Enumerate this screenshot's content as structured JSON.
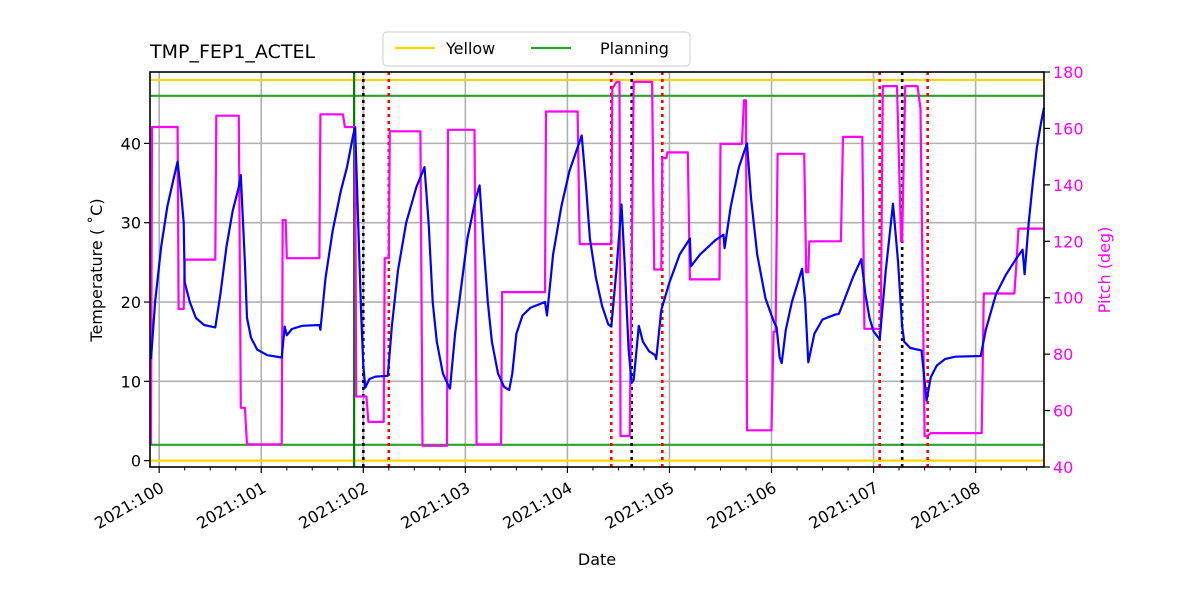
{
  "chart_data": {
    "type": "line",
    "title": "TMP_FEP1_ACTEL",
    "xlabel": "Date",
    "ylabel": "Temperature ($^\\circ$C)",
    "ylabel_display": "Temperature ( ˚C)",
    "y2label": "Pitch (deg)",
    "xlim": [
      99.91,
      108.67
    ],
    "ylim": [
      -0.8,
      49
    ],
    "y2lim": [
      40,
      180
    ],
    "grid": true,
    "legend": {
      "placement": "top-center",
      "entries": [
        {
          "label": "Yellow",
          "color": "#ffd700"
        },
        {
          "label": "Planning",
          "color": "#2ca02c"
        }
      ]
    },
    "x_ticks": [
      {
        "value": 100,
        "label": "2021:100"
      },
      {
        "value": 101,
        "label": "2021:101"
      },
      {
        "value": 102,
        "label": "2021:102"
      },
      {
        "value": 103,
        "label": "2021:103"
      },
      {
        "value": 104,
        "label": "2021:104"
      },
      {
        "value": 105,
        "label": "2021:105"
      },
      {
        "value": 106,
        "label": "2021:106"
      },
      {
        "value": 107,
        "label": "2021:107"
      },
      {
        "value": 108,
        "label": "2021:108"
      }
    ],
    "y_ticks": [
      0,
      10,
      20,
      30,
      40
    ],
    "y2_ticks": [
      40,
      60,
      80,
      100,
      120,
      140,
      160,
      180
    ],
    "limits": [
      {
        "name": "Yellow",
        "values": [
          48,
          0
        ],
        "color": "#ffd700"
      },
      {
        "name": "Planning",
        "values": [
          46,
          2
        ],
        "color": "#2ca02c"
      }
    ],
    "vlines": [
      {
        "kind": "green-solid",
        "x": 101.91,
        "color": "#008000"
      },
      {
        "kind": "black-dotted",
        "x": 102.0,
        "color": "#000000"
      },
      {
        "kind": "red-dotted",
        "x": 102.25,
        "color": "#ff0000"
      },
      {
        "kind": "red-dotted",
        "x": 104.43,
        "color": "#ff0000"
      },
      {
        "kind": "black-dotted",
        "x": 104.63,
        "color": "#000000"
      },
      {
        "kind": "red-dotted",
        "x": 104.93,
        "color": "#ff0000"
      },
      {
        "kind": "red-dotted",
        "x": 107.06,
        "color": "#ff0000"
      },
      {
        "kind": "black-dotted",
        "x": 107.28,
        "color": "#000000"
      },
      {
        "kind": "red-dotted",
        "x": 107.53,
        "color": "#ff0000"
      }
    ],
    "series": [
      {
        "name": "Temperature",
        "axis": "left",
        "color": "#0000ff",
        "points": [
          [
            99.92,
            12.8
          ],
          [
            99.96,
            20
          ],
          [
            100.02,
            27
          ],
          [
            100.08,
            32
          ],
          [
            100.14,
            35.5
          ],
          [
            100.18,
            37.7
          ],
          [
            100.22,
            33
          ],
          [
            100.24,
            30
          ],
          [
            100.25,
            22.5
          ],
          [
            100.3,
            20
          ],
          [
            100.36,
            18
          ],
          [
            100.44,
            17.1
          ],
          [
            100.55,
            16.8
          ],
          [
            100.6,
            21
          ],
          [
            100.66,
            27
          ],
          [
            100.72,
            31.5
          ],
          [
            100.78,
            34.5
          ],
          [
            100.8,
            36
          ],
          [
            100.84,
            25
          ],
          [
            100.86,
            18
          ],
          [
            100.9,
            15.5
          ],
          [
            100.96,
            14
          ],
          [
            101.06,
            13.3
          ],
          [
            101.2,
            13.0
          ],
          [
            101.23,
            16.9
          ],
          [
            101.25,
            15.8
          ],
          [
            101.3,
            16.6
          ],
          [
            101.4,
            17
          ],
          [
            101.57,
            17.1
          ],
          [
            101.58,
            16.5
          ],
          [
            101.63,
            23
          ],
          [
            101.7,
            29
          ],
          [
            101.78,
            34
          ],
          [
            101.84,
            37
          ],
          [
            101.9,
            41
          ],
          [
            101.92,
            42
          ],
          [
            101.95,
            30
          ],
          [
            101.98,
            18
          ],
          [
            102.0,
            12
          ],
          [
            102.02,
            9.2
          ],
          [
            102.06,
            10.3
          ],
          [
            102.12,
            10.6
          ],
          [
            102.24,
            10.7
          ],
          [
            102.28,
            17
          ],
          [
            102.34,
            24
          ],
          [
            102.42,
            30
          ],
          [
            102.52,
            34.5
          ],
          [
            102.6,
            37
          ],
          [
            102.64,
            30
          ],
          [
            102.68,
            20
          ],
          [
            102.72,
            15
          ],
          [
            102.78,
            11
          ],
          [
            102.84,
            9.3
          ],
          [
            102.85,
            9.1
          ],
          [
            102.9,
            16
          ],
          [
            102.96,
            22
          ],
          [
            103.02,
            28
          ],
          [
            103.1,
            33
          ],
          [
            103.14,
            34.7
          ],
          [
            103.18,
            27
          ],
          [
            103.22,
            20
          ],
          [
            103.26,
            15
          ],
          [
            103.32,
            11
          ],
          [
            103.38,
            9.3
          ],
          [
            103.43,
            8.9
          ],
          [
            103.46,
            11
          ],
          [
            103.5,
            16
          ],
          [
            103.56,
            18.3
          ],
          [
            103.64,
            19.3
          ],
          [
            103.78,
            20
          ],
          [
            103.8,
            18.3
          ],
          [
            103.86,
            26
          ],
          [
            103.94,
            32
          ],
          [
            104.02,
            36.5
          ],
          [
            104.1,
            39.5
          ],
          [
            104.14,
            41
          ],
          [
            104.18,
            35
          ],
          [
            104.22,
            28
          ],
          [
            104.28,
            23
          ],
          [
            104.34,
            19.5
          ],
          [
            104.4,
            17.2
          ],
          [
            104.43,
            16.9
          ],
          [
            104.48,
            24
          ],
          [
            104.53,
            32.3
          ],
          [
            104.56,
            25
          ],
          [
            104.6,
            14
          ],
          [
            104.63,
            9.8
          ],
          [
            104.65,
            10.2
          ],
          [
            104.7,
            17
          ],
          [
            104.74,
            15
          ],
          [
            104.8,
            13.8
          ],
          [
            104.86,
            13.3
          ],
          [
            104.87,
            12.8
          ],
          [
            104.92,
            19
          ],
          [
            105.0,
            22.5
          ],
          [
            105.1,
            26
          ],
          [
            105.2,
            28
          ],
          [
            105.21,
            24.5
          ],
          [
            105.3,
            26
          ],
          [
            105.45,
            27.8
          ],
          [
            105.53,
            28.5
          ],
          [
            105.54,
            26.8
          ],
          [
            105.6,
            32
          ],
          [
            105.68,
            37
          ],
          [
            105.76,
            40
          ],
          [
            105.8,
            33
          ],
          [
            105.86,
            26
          ],
          [
            105.94,
            20.5
          ],
          [
            106.02,
            17.6
          ],
          [
            106.05,
            16.8
          ],
          [
            106.08,
            13
          ],
          [
            106.1,
            12.3
          ],
          [
            106.14,
            16.5
          ],
          [
            106.2,
            20
          ],
          [
            106.3,
            24.2
          ],
          [
            106.33,
            20
          ],
          [
            106.36,
            12.4
          ],
          [
            106.42,
            16
          ],
          [
            106.5,
            17.8
          ],
          [
            106.62,
            18.4
          ],
          [
            106.66,
            18.5
          ],
          [
            106.72,
            20.5
          ],
          [
            106.8,
            23.2
          ],
          [
            106.88,
            25.4
          ],
          [
            106.92,
            21
          ],
          [
            106.96,
            18
          ],
          [
            107.0,
            16.3
          ],
          [
            107.06,
            15.3
          ],
          [
            107.12,
            24
          ],
          [
            107.19,
            32.4
          ],
          [
            107.24,
            25
          ],
          [
            107.28,
            17
          ],
          [
            107.3,
            15
          ],
          [
            107.36,
            14.2
          ],
          [
            107.47,
            13.9
          ],
          [
            107.5,
            10
          ],
          [
            107.52,
            7.6
          ],
          [
            107.56,
            10.5
          ],
          [
            107.62,
            12
          ],
          [
            107.7,
            12.8
          ],
          [
            107.8,
            13.1
          ],
          [
            108.05,
            13.2
          ],
          [
            108.1,
            16.5
          ],
          [
            108.2,
            21
          ],
          [
            108.3,
            23.5
          ],
          [
            108.4,
            25.5
          ],
          [
            108.46,
            26.6
          ],
          [
            108.48,
            23.5
          ],
          [
            108.52,
            30
          ],
          [
            108.56,
            35
          ],
          [
            108.6,
            39.5
          ],
          [
            108.64,
            42.5
          ],
          [
            108.67,
            44.5
          ]
        ]
      },
      {
        "name": "Pitch",
        "axis": "right",
        "color": "#ff00ff",
        "points": [
          [
            99.92,
            48
          ],
          [
            99.93,
            160.5
          ],
          [
            100.18,
            160.5
          ],
          [
            100.19,
            96
          ],
          [
            100.24,
            96
          ],
          [
            100.25,
            113.5
          ],
          [
            100.55,
            113.5
          ],
          [
            100.56,
            164.5
          ],
          [
            100.78,
            164.5
          ],
          [
            100.8,
            61
          ],
          [
            100.84,
            61
          ],
          [
            100.86,
            48
          ],
          [
            101.2,
            48
          ],
          [
            101.21,
            127.5
          ],
          [
            101.24,
            127.5
          ],
          [
            101.25,
            114
          ],
          [
            101.57,
            114
          ],
          [
            101.58,
            165
          ],
          [
            101.8,
            165
          ],
          [
            101.82,
            160.5
          ],
          [
            101.92,
            160.5
          ],
          [
            101.93,
            65
          ],
          [
            102.03,
            65
          ],
          [
            102.05,
            56
          ],
          [
            102.2,
            56
          ],
          [
            102.21,
            114
          ],
          [
            102.25,
            114
          ],
          [
            102.26,
            159
          ],
          [
            102.56,
            159
          ],
          [
            102.58,
            47.5
          ],
          [
            102.82,
            47.5
          ],
          [
            102.83,
            159.5
          ],
          [
            103.09,
            159.5
          ],
          [
            103.11,
            48
          ],
          [
            103.35,
            48
          ],
          [
            103.36,
            102
          ],
          [
            103.78,
            102
          ],
          [
            103.79,
            166
          ],
          [
            104.1,
            166
          ],
          [
            104.12,
            119
          ],
          [
            104.43,
            119
          ],
          [
            104.44,
            174
          ],
          [
            104.48,
            176.5
          ],
          [
            104.51,
            176.5
          ],
          [
            104.52,
            51
          ],
          [
            104.61,
            51
          ],
          [
            104.65,
            176.5
          ],
          [
            104.83,
            176.5
          ],
          [
            104.85,
            110
          ],
          [
            104.92,
            110
          ],
          [
            104.93,
            149.5
          ],
          [
            104.97,
            149.5
          ],
          [
            104.98,
            151.5
          ],
          [
            105.18,
            151.5
          ],
          [
            105.2,
            106.5
          ],
          [
            105.49,
            106.5
          ],
          [
            105.5,
            154.5
          ],
          [
            105.71,
            154.5
          ],
          [
            105.73,
            170
          ],
          [
            105.75,
            170
          ],
          [
            105.76,
            53
          ],
          [
            106.0,
            53
          ],
          [
            106.02,
            88
          ],
          [
            106.04,
            88
          ],
          [
            106.06,
            151
          ],
          [
            106.32,
            151
          ],
          [
            106.34,
            109
          ],
          [
            106.36,
            109
          ],
          [
            106.37,
            120
          ],
          [
            106.68,
            120
          ],
          [
            106.7,
            157
          ],
          [
            106.89,
            157
          ],
          [
            106.91,
            89
          ],
          [
            107.07,
            89
          ],
          [
            107.09,
            175
          ],
          [
            107.23,
            175
          ],
          [
            107.27,
            120
          ],
          [
            107.28,
            120
          ],
          [
            107.31,
            175
          ],
          [
            107.43,
            175
          ],
          [
            107.46,
            167
          ],
          [
            107.5,
            51
          ],
          [
            107.53,
            51
          ],
          [
            107.56,
            52
          ],
          [
            108.06,
            52
          ],
          [
            108.08,
            101.5
          ],
          [
            108.38,
            101.5
          ],
          [
            108.4,
            112
          ],
          [
            108.42,
            124.5
          ],
          [
            108.67,
            124.5
          ]
        ]
      }
    ]
  }
}
